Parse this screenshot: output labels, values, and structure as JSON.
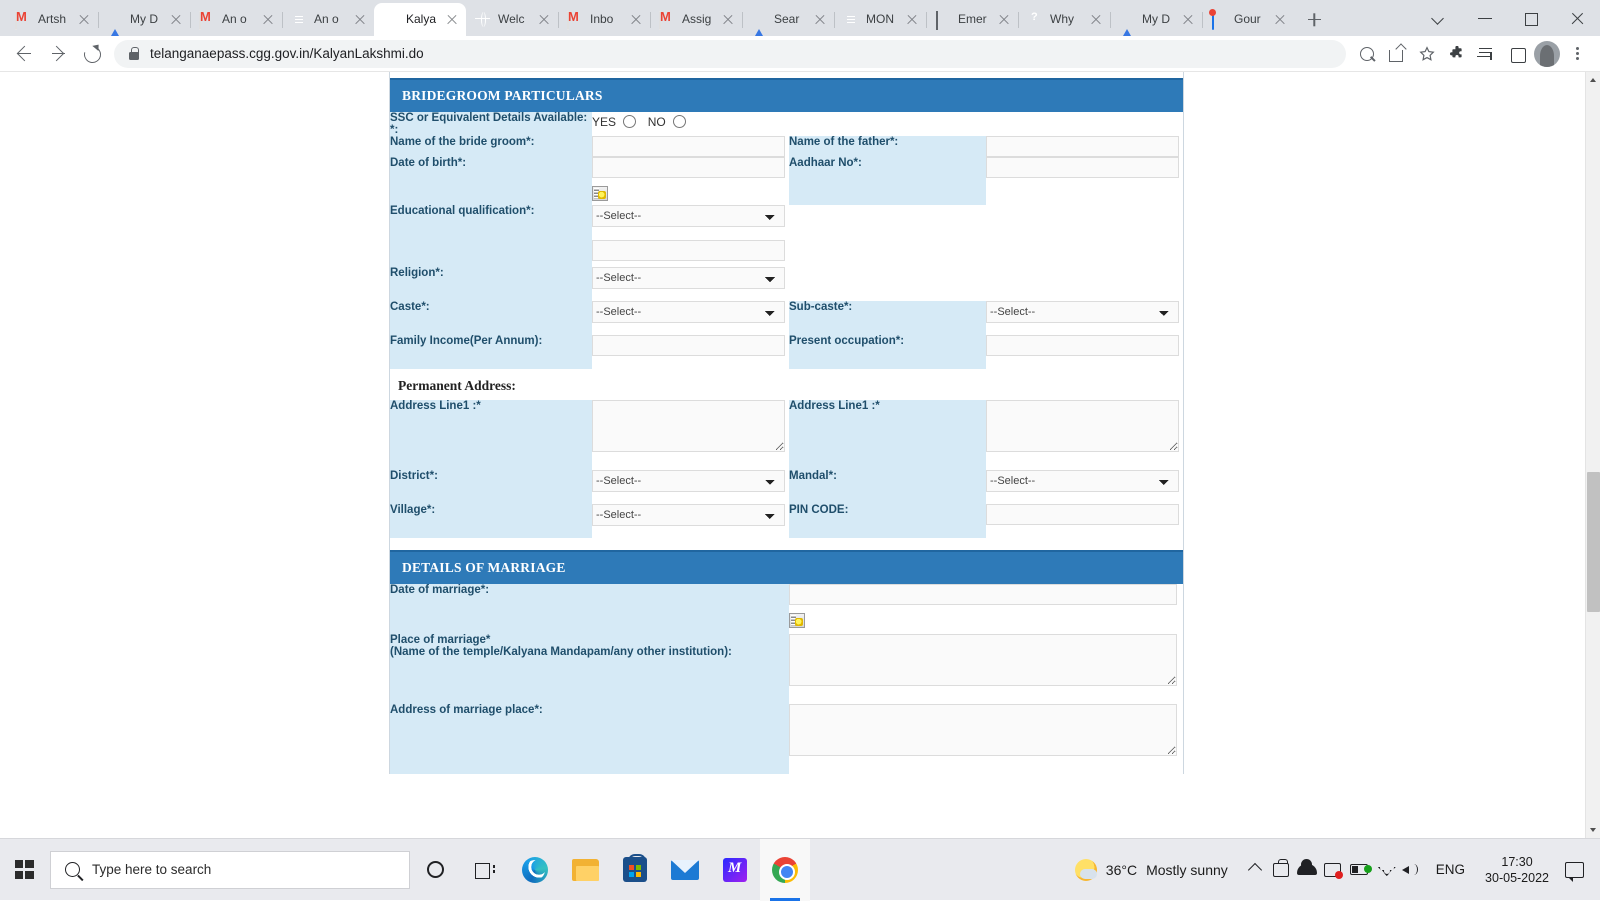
{
  "browser": {
    "tabs": [
      {
        "label": "Artsh",
        "icon": "gmail-icon"
      },
      {
        "label": "My D",
        "icon": "drive-icon"
      },
      {
        "label": "An o",
        "icon": "gmail-icon"
      },
      {
        "label": "An o",
        "icon": "docs-icon"
      },
      {
        "label": "Kalya",
        "icon": "globe-icon",
        "active": true
      },
      {
        "label": "Welc",
        "icon": "globe-icon"
      },
      {
        "label": "Inbo",
        "icon": "gmail-icon"
      },
      {
        "label": "Assig",
        "icon": "gmail-icon"
      },
      {
        "label": "Sear",
        "icon": "drive-icon"
      },
      {
        "label": "MON",
        "icon": "docs-icon"
      },
      {
        "label": "Emer",
        "icon": "photo-icon"
      },
      {
        "label": "Why",
        "icon": "why-icon"
      },
      {
        "label": "My D",
        "icon": "drive-icon"
      },
      {
        "label": "Gour",
        "icon": "gour-icon"
      }
    ],
    "new_tab_label": "New tab",
    "window_controls": [
      "tab-search",
      "minimize",
      "maximize",
      "close"
    ],
    "url": "telanganaepass.cgg.gov.in/KalyanLakshmi.do",
    "nav": {
      "back": "Back",
      "forward": "Forward",
      "reload": "Reload"
    },
    "toolbar_icons": [
      "zoom-out-icon",
      "share-icon",
      "bookmark-star-icon",
      "extensions-icon",
      "media-control-icon",
      "side-panel-icon",
      "profile-avatar",
      "chrome-menu-icon"
    ]
  },
  "form": {
    "sections": [
      {
        "title": "BRIDEGROOM PARTICULARS",
        "rows": [
          {
            "type": "radio",
            "left_label": "SSC or Equivalent Details Available: *:",
            "options": [
              "YES",
              "NO"
            ]
          },
          {
            "type": "pair-text",
            "left_label": "Name of the bride groom*:",
            "left_value": "",
            "right_label": "Name of the father*:",
            "right_value": ""
          },
          {
            "type": "date",
            "left_label": "Date of birth*:",
            "left_value": "",
            "right_label": "Aadhaar No*:",
            "right_value": "",
            "calendar_icon": "calendar-icon"
          },
          {
            "type": "select-plus-text",
            "left_label": "Educational qualification*:",
            "left_value": "--Select--",
            "extra_value": ""
          },
          {
            "type": "select-single",
            "left_label": "Religion*:",
            "left_value": "--Select--"
          },
          {
            "type": "pair-select",
            "left_label": "Caste*:",
            "left_value": "--Select--",
            "right_label": "Sub-caste*:",
            "right_value": "--Select--"
          },
          {
            "type": "pair-text",
            "left_label": "Family Income(Per Annum):",
            "left_value": "",
            "right_label": "Present occupation*:",
            "right_value": ""
          }
        ],
        "subheading": "Permanent Address:",
        "address_rows": [
          {
            "type": "pair-textarea",
            "left_label": "Address Line1 :*",
            "left_value": "",
            "right_label": "Address Line1 :*",
            "right_value": ""
          },
          {
            "type": "pair-select",
            "left_label": "District*:",
            "left_value": "--Select--",
            "right_label": "Mandal*:",
            "right_value": "--Select--"
          },
          {
            "type": "select-and-text",
            "left_label": "Village*:",
            "left_value": "--Select--",
            "right_label": "PIN CODE:",
            "right_value": ""
          }
        ]
      },
      {
        "title": "DETAILS OF MARRIAGE",
        "rows": [
          {
            "type": "date-wide",
            "left_label": "Date of marriage*:",
            "left_value": "",
            "calendar_icon": "calendar-icon"
          },
          {
            "type": "textarea-wide",
            "left_label_line1": "Place of marriage*",
            "left_label_line2": "(Name of the temple/Kalyana Mandapam/any other institution):",
            "left_value": ""
          },
          {
            "type": "textarea-wide-2",
            "left_label": "Address of marriage place*:",
            "left_value": ""
          }
        ]
      }
    ],
    "select_placeholder": "--Select--"
  },
  "taskbar": {
    "start_label": "Start",
    "search_placeholder": "Type here to search",
    "apps": [
      {
        "name": "cortana-icon"
      },
      {
        "name": "task-view-icon"
      },
      {
        "name": "edge-icon"
      },
      {
        "name": "file-explorer-icon"
      },
      {
        "name": "microsoft-store-icon"
      },
      {
        "name": "mail-icon"
      },
      {
        "name": "movie-maker-icon"
      },
      {
        "name": "chrome-icon",
        "active": true
      }
    ],
    "weather": {
      "temperature": "36°C",
      "description": "Mostly sunny"
    },
    "tray_icons": [
      "show-hidden-icons",
      "cast-icon",
      "onedrive-icon",
      "screen-capture-icon",
      "battery-icon",
      "wifi-icon",
      "volume-icon"
    ],
    "language": "ENG",
    "time": "17:30",
    "date": "30-05-2022",
    "notification_icon": "notification-icon"
  },
  "colors": {
    "section_header_bg": "#2e7ab8",
    "label_cell_bg": "#d6eaf6",
    "label_text": "#20536f",
    "input_bg": "#fafafa",
    "page_bg": "#ffffff",
    "chrome_bg": "#dee1e6",
    "taskbar_bg": "#e9eaee"
  }
}
